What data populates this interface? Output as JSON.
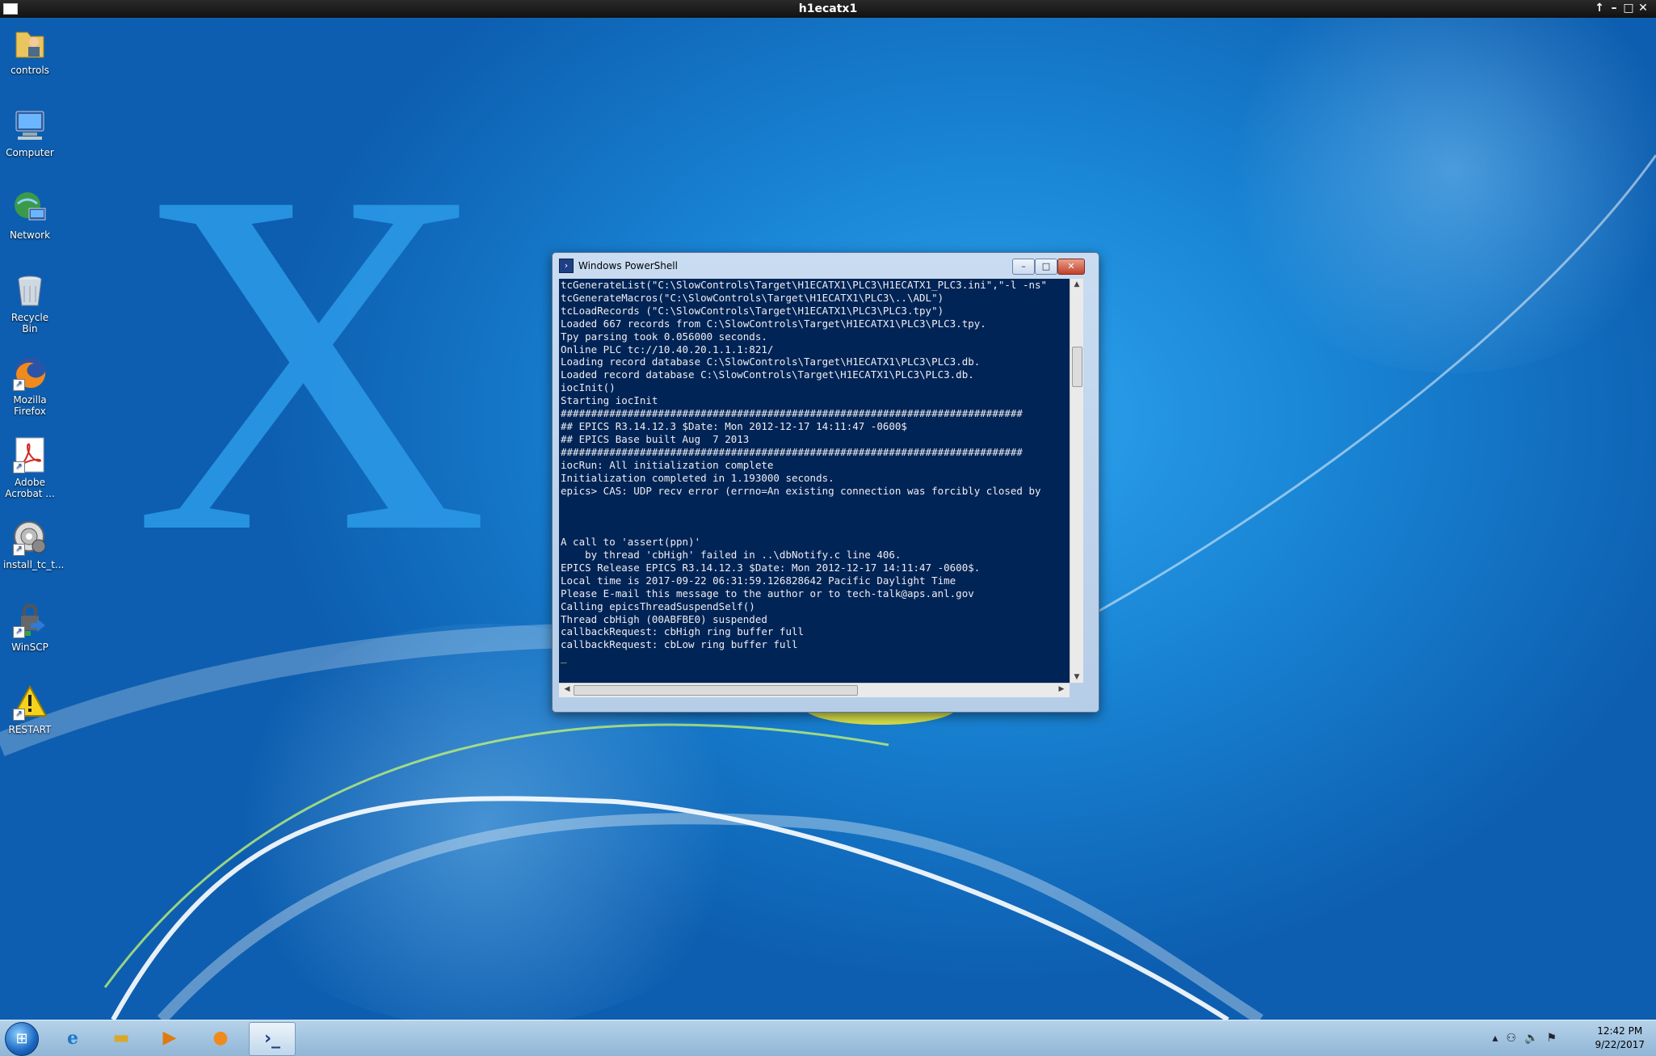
{
  "viewer": {
    "title": "h1ecatx1"
  },
  "desktop_icons": [
    {
      "label": "controls",
      "icon": "folder-user-icon"
    },
    {
      "label": "Computer",
      "icon": "computer-icon"
    },
    {
      "label": "Network",
      "icon": "network-icon"
    },
    {
      "label": "Recycle Bin",
      "icon": "recycle-bin-icon"
    },
    {
      "label": "Mozilla Firefox",
      "icon": "firefox-icon"
    },
    {
      "label": "Adobe Acrobat ...",
      "icon": "acrobat-icon"
    },
    {
      "label": "install_tc_t...",
      "icon": "gear-disc-icon"
    },
    {
      "label": "WinSCP",
      "icon": "winscp-icon"
    },
    {
      "label": "RESTART",
      "icon": "warning-icon"
    }
  ],
  "wallpaper": {
    "letter": "X"
  },
  "powershell": {
    "title": "Windows PowerShell",
    "lines": [
      "tcGenerateList(\"C:\\SlowControls\\Target\\H1ECATX1\\PLC3\\H1ECATX1_PLC3.ini\",\"-l -ns\"",
      "tcGenerateMacros(\"C:\\SlowControls\\Target\\H1ECATX1\\PLC3\\..\\ADL\")",
      "tcLoadRecords (\"C:\\SlowControls\\Target\\H1ECATX1\\PLC3\\PLC3.tpy\")",
      "Loaded 667 records from C:\\SlowControls\\Target\\H1ECATX1\\PLC3\\PLC3.tpy.",
      "Tpy parsing took 0.056000 seconds.",
      "Online PLC tc://10.40.20.1.1.1:821/",
      "Loading record database C:\\SlowControls\\Target\\H1ECATX1\\PLC3\\PLC3.db.",
      "Loaded record database C:\\SlowControls\\Target\\H1ECATX1\\PLC3\\PLC3.db.",
      "iocInit()",
      "Starting iocInit",
      "############################################################################",
      "## EPICS R3.14.12.3 $Date: Mon 2012-12-17 14:11:47 -0600$",
      "## EPICS Base built Aug  7 2013",
      "############################################################################",
      "iocRun: All initialization complete",
      "Initialization completed in 1.193000 seconds.",
      "epics> CAS: UDP recv error (errno=An existing connection was forcibly closed by",
      "",
      "",
      "",
      "A call to 'assert(ppn)'",
      "    by thread 'cbHigh' failed in ..\\dbNotify.c line 406.",
      "EPICS Release EPICS R3.14.12.3 $Date: Mon 2012-12-17 14:11:47 -0600$.",
      "Local time is 2017-09-22 06:31:59.126828642 Pacific Daylight Time",
      "Please E-mail this message to the author or to tech-talk@aps.anl.gov",
      "Calling epicsThreadSuspendSelf()",
      "Thread cbHigh (00ABFBE0) suspended",
      "callbackRequest: cbHigh ring buffer full",
      "callbackRequest: cbLow ring buffer full"
    ],
    "cursor": "_"
  },
  "taskbar": {
    "items": [
      {
        "name": "internet-explorer",
        "icon": "ie-icon"
      },
      {
        "name": "windows-explorer",
        "icon": "folder-icon"
      },
      {
        "name": "media-player",
        "icon": "media-player-icon"
      },
      {
        "name": "firefox",
        "icon": "firefox-icon"
      },
      {
        "name": "powershell",
        "icon": "powershell-icon"
      }
    ],
    "clock": {
      "time": "12:42 PM",
      "date": "9/22/2017"
    }
  }
}
